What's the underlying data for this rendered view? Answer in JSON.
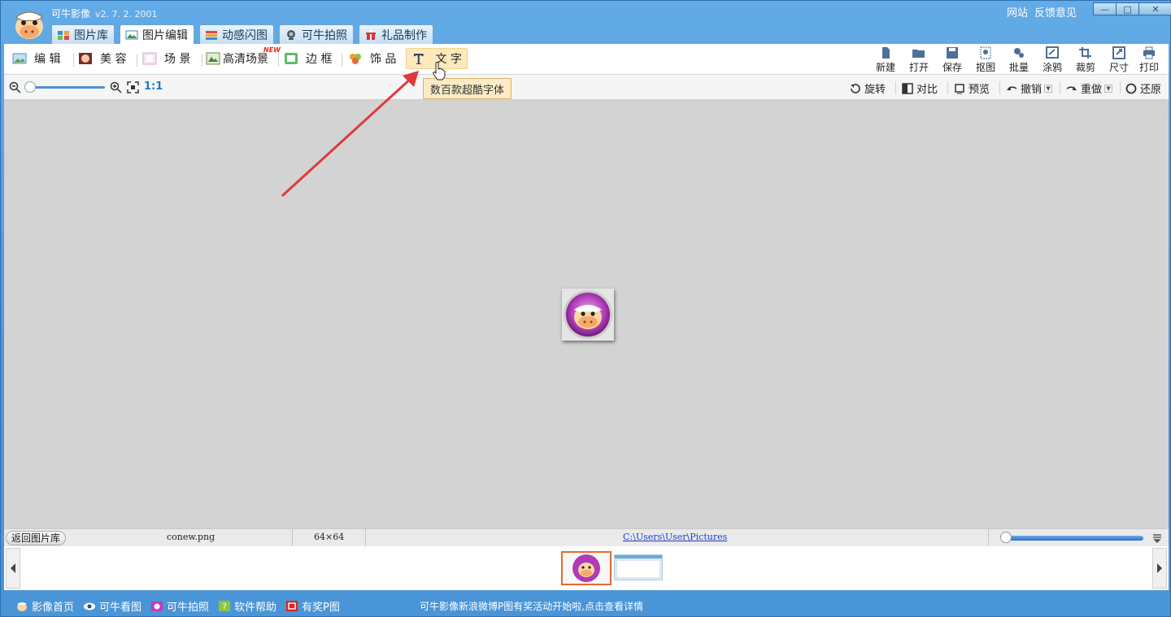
{
  "app": {
    "title": "可牛影像",
    "version": "v2. 7. 2. 2001"
  },
  "top_links": [
    "网站",
    "反馈意见"
  ],
  "window_buttons": {
    "minimize": "—",
    "maximize": "□",
    "close": "✕"
  },
  "main_tabs": [
    {
      "label": "图片库",
      "active": false
    },
    {
      "label": "图片编辑",
      "active": true
    },
    {
      "label": "动感闪图",
      "active": false
    },
    {
      "label": "可牛拍照",
      "active": false
    },
    {
      "label": "礼品制作",
      "active": false
    }
  ],
  "feature_tools": [
    {
      "label": "编 辑",
      "icon": "edit-image-icon"
    },
    {
      "label": "美 容",
      "icon": "beauty-face-icon"
    },
    {
      "label": "场 景",
      "icon": "scene-icon"
    },
    {
      "label": "高清场景",
      "icon": "hd-scene-icon"
    },
    {
      "label": "边 框",
      "icon": "frame-icon"
    },
    {
      "label": "饰 品",
      "icon": "accessory-icon"
    },
    {
      "label": "文 字",
      "icon": "text-icon"
    }
  ],
  "new_badge": "NEW",
  "right_tools": [
    "新建",
    "打开",
    "保存",
    "抠图",
    "批量",
    "涂鸦",
    "裁剪",
    "尺寸",
    "打印"
  ],
  "zoom": {
    "ratio_label": "1:1",
    "level": 0.02
  },
  "view_tools": {
    "rotate": "旋转",
    "compare": "对比",
    "preview": "预览",
    "undo": "撤销",
    "redo": "重做",
    "restore": "还原"
  },
  "tooltip": "数百款超酷字体",
  "status": {
    "back_button": "返回图片库",
    "filename": "conew.png",
    "dimensions": "64×64",
    "path": "C:\\Users\\User\\Pictures"
  },
  "thumbnail_size": 0.97,
  "bottom_links": [
    "影像首页",
    "可牛看图",
    "可牛拍照",
    "软件帮助",
    "有奖P图"
  ],
  "news": "可牛影像新浪微博P图有奖活动开始啦,点击查看详情",
  "colors": {
    "accent": "#4b97d9",
    "arrow": "#e0393a",
    "tooltip_bg": "#fcebc5",
    "path_link": "#1a3fd0"
  }
}
